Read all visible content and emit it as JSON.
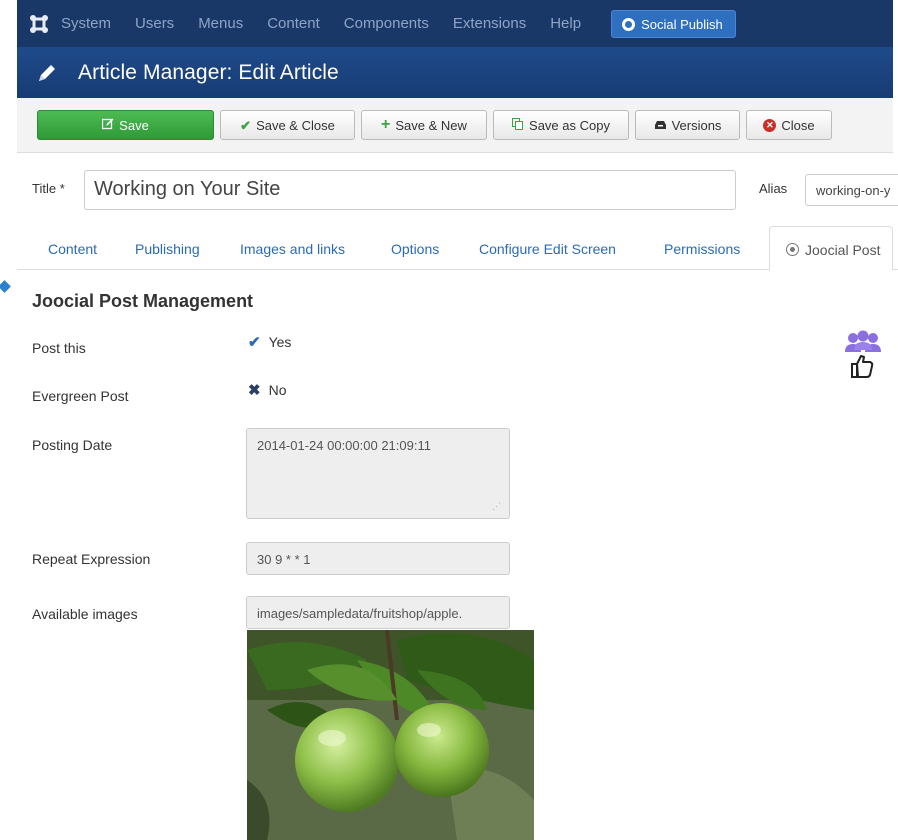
{
  "topnav": {
    "menu": [
      "System",
      "Users",
      "Menus",
      "Content",
      "Components",
      "Extensions",
      "Help"
    ],
    "social_button": "Social Publish"
  },
  "header": {
    "title": "Article Manager: Edit Article"
  },
  "toolbar": {
    "save": "Save",
    "save_close": "Save & Close",
    "save_new": "Save & New",
    "save_copy": "Save as Copy",
    "versions": "Versions",
    "close": "Close"
  },
  "form": {
    "title_label": "Title *",
    "title_value": "Working on Your Site",
    "alias_label": "Alias",
    "alias_value": "working-on-y"
  },
  "tabs": [
    "Content",
    "Publishing",
    "Images and links",
    "Options",
    "Configure Edit Screen",
    "Permissions",
    "Joocial Post"
  ],
  "panel": {
    "heading": "Joocial Post Management",
    "post_this_label": "Post this",
    "post_this_value": "Yes",
    "evergreen_label": "Evergreen Post",
    "evergreen_value": "No",
    "posting_date_label": "Posting Date",
    "posting_date_value": "2014-01-24 00:00:00 21:09:11",
    "repeat_label": "Repeat Expression",
    "repeat_value": "30 9 * * 1",
    "images_label": "Available images",
    "images_value": "images/sampledata/fruitshop/apple."
  },
  "colors": {
    "topnav_bg": "#1a3867",
    "header_bg": "#1f4a8a",
    "save_green": "#3ba344",
    "link_blue": "#2a6bb7",
    "group_icon_purple": "#8b6fe0"
  }
}
